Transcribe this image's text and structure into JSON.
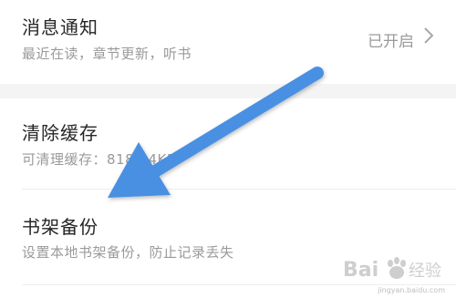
{
  "settings": {
    "notifications": {
      "title": "消息通知",
      "subtitle": "最近在读，章节更新，听书",
      "status": "已开启"
    },
    "clear_cache": {
      "title": "清除缓存",
      "subtitle": "可清理缓存：818.14KB"
    },
    "bookshelf_backup": {
      "title": "书架备份",
      "subtitle": "设置本地书架备份，防止记录丢失"
    }
  },
  "icons": {
    "chevron": "chevron-right-icon"
  },
  "annotation": {
    "arrow_color": "#4a90e2"
  },
  "watermark": {
    "brand": "Baidu经验",
    "url": "jingyan.baidu.com"
  }
}
